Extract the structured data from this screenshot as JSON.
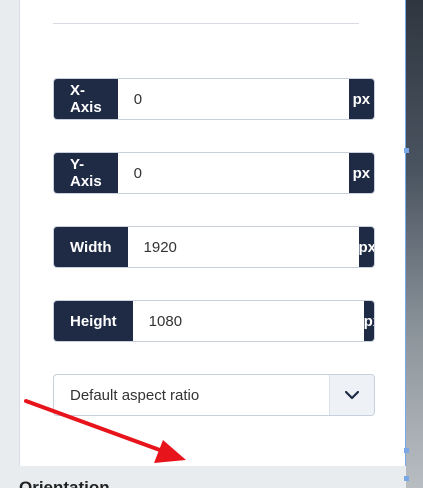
{
  "fields": [
    {
      "label": "X-Axis",
      "value": "0",
      "unit": "px"
    },
    {
      "label": "Y-Axis",
      "value": "0",
      "unit": "px"
    },
    {
      "label": "Width",
      "value": "1920",
      "unit": "px"
    },
    {
      "label": "Height",
      "value": "1080",
      "unit": "px"
    }
  ],
  "aspect_select": {
    "value": "Default aspect ratio",
    "icon": "chevron-down-icon"
  },
  "next_section": {
    "heading": "Orientation"
  },
  "annotation": {
    "icon": "red-arrow-icon",
    "color": "#e8141b"
  },
  "colors": {
    "label_bg": "#1f2a44",
    "selection": "#7aa7e6"
  }
}
